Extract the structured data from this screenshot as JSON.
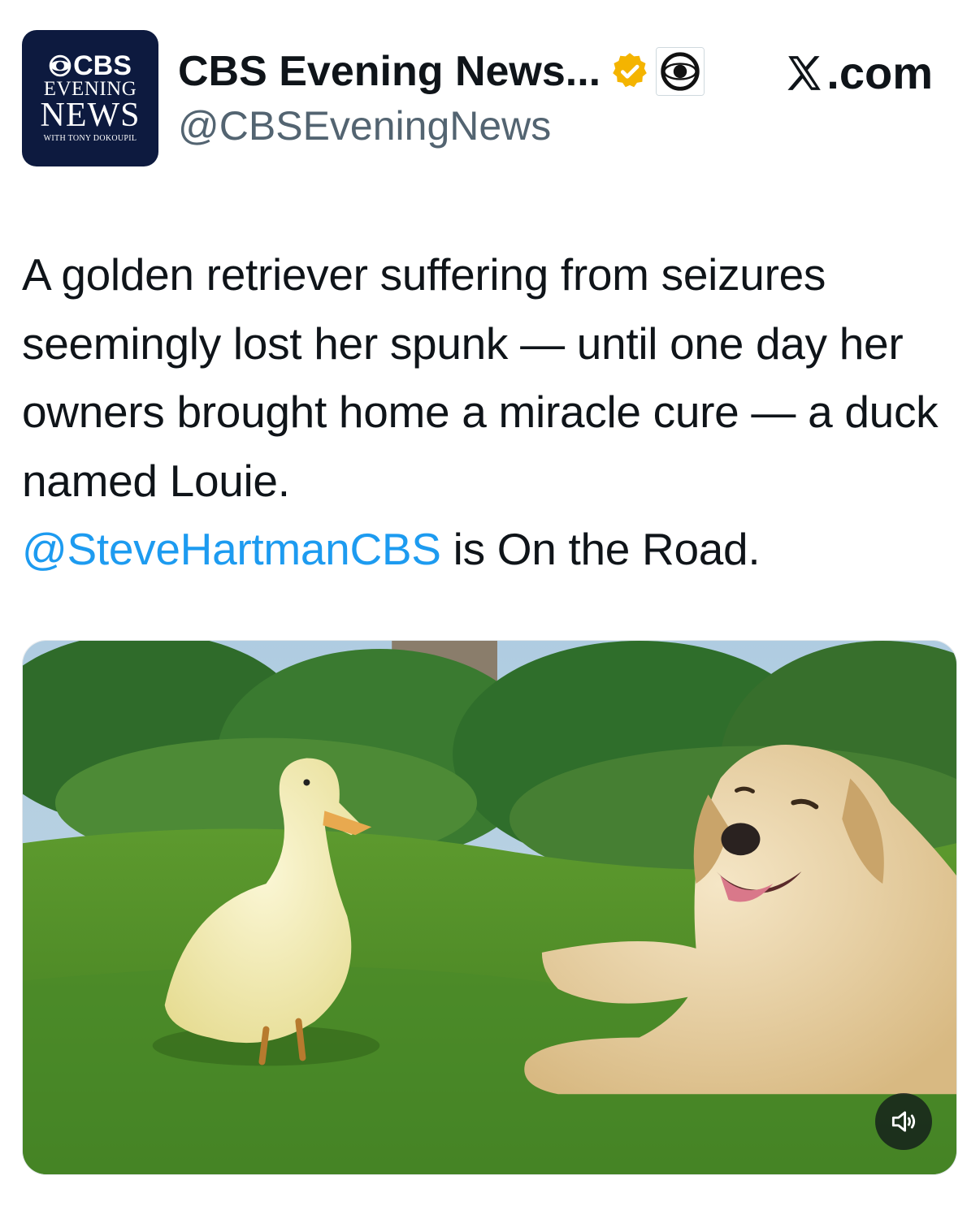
{
  "author": {
    "display_name": "CBS Evening News...",
    "handle": "@CBSEveningNews",
    "avatar": {
      "line1": "CBS",
      "line2": "EVENING",
      "line3": "NEWS",
      "line4": "WITH TONY DOKOUPIL"
    },
    "verified_badge": "gold-verified-icon",
    "affiliation_badge": "cbs-eye-icon"
  },
  "site": {
    "label": ".com",
    "icon": "x-logo-icon"
  },
  "tweet": {
    "text_part1": "A golden retriever suffering from seizures seemingly lost her spunk — until one day her owners brought home a miracle cure — a duck named Louie.",
    "mention": "@SteveHartmanCBS",
    "text_part2": " is On the Road."
  },
  "media": {
    "type": "video",
    "mute_icon": "speaker-icon"
  },
  "colors": {
    "link": "#1d9bf0",
    "handle": "#536471",
    "avatar_bg": "#0d1a3f",
    "verified": "#f4b400"
  }
}
